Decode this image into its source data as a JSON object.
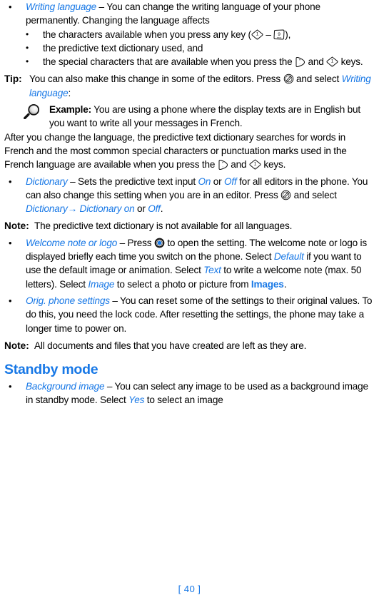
{
  "colors": {
    "accent_blue": "#1878e6",
    "text_black": "#000000",
    "page_background": "#ffffff"
  },
  "page": {
    "number_label": "[ 40 ]"
  },
  "icons": {
    "key_1": "key-1-icon",
    "key_9": "key-9-icon",
    "key_star": "key-star-icon",
    "key_options": "options-pencil-key-icon",
    "key_scroll": "scroll-select-key-icon",
    "magnifier": "magnifier-example-icon",
    "bullet": "•",
    "arrow": "→"
  },
  "content": {
    "writing_language": {
      "term": "Writing language",
      "dash": " – ",
      "intro": "You can change the writing language of your phone permanently. Changing the language affects",
      "sub_bullets": [
        {
          "before": "the characters available when you press any key (",
          "middle": " – ",
          "after": "),"
        },
        {
          "text": "the predictive text dictionary used, and"
        },
        {
          "before": "the special characters that are available when you press the ",
          "middle": " and ",
          "after": " keys."
        }
      ]
    },
    "tip": {
      "label": "Tip:",
      "part1": "You can also make this change in some of the editors. Press ",
      "part2": " and select ",
      "term": "Writing language",
      "part3": ":"
    },
    "example": {
      "label": "Example:",
      "head_text": "You are using a phone where the display texts are in English but you want to write all your messages in French.",
      "body_part1": "After you change the language, the predictive text dictionary searches for words in French and the most common special characters or punctuation marks used in the French language are available when you press the ",
      "body_part2": " and ",
      "body_part3": " keys."
    },
    "dictionary": {
      "term": "Dictionary",
      "dash": " – ",
      "part1": "Sets the predictive text input ",
      "on": "On",
      "or1": " or ",
      "off1": "Off",
      "part2": " for all editors in the phone. You can also change this setting when you are in an editor. Press ",
      "part3": " and select ",
      "menu1": "Dictionary",
      "arrow": "→",
      "menu2": " Dictionary on",
      "or2": " or ",
      "off2": "Off",
      "period": "."
    },
    "note_dictionary": {
      "label": "Note:",
      "text": "The predictive text dictionary is not available for all languages."
    },
    "welcome_note": {
      "term": "Welcome note or logo",
      "dash": " – ",
      "part1": "Press ",
      "part2": " to open the setting. The welcome note or logo is displayed briefly each time you switch on the phone. Select ",
      "default": "Default",
      "part3": " if you want to use the default image or animation. Select ",
      "text_option": "Text",
      "part4": " to write a welcome note (max. 50 letters). Select ",
      "image_option": "Image",
      "part5": " to select a photo or picture from ",
      "images_app": "Images",
      "part6": "."
    },
    "orig_phone_settings": {
      "term": "Orig. phone settings",
      "dash": " – ",
      "text": "You can reset some of the settings to their original values. To do this, you need the lock code. After resetting the settings, the phone may take a longer time to power on."
    },
    "note_documents": {
      "label": "Note:",
      "text": "All documents and files that you have created are left as they are."
    },
    "standby_mode": {
      "heading": "Standby mode",
      "background_image": {
        "term": "Background image",
        "dash": " – ",
        "part1": "You can select any image to be used as a background image in standby mode. Select ",
        "yes": "Yes",
        "part2": " to select an image"
      }
    }
  }
}
